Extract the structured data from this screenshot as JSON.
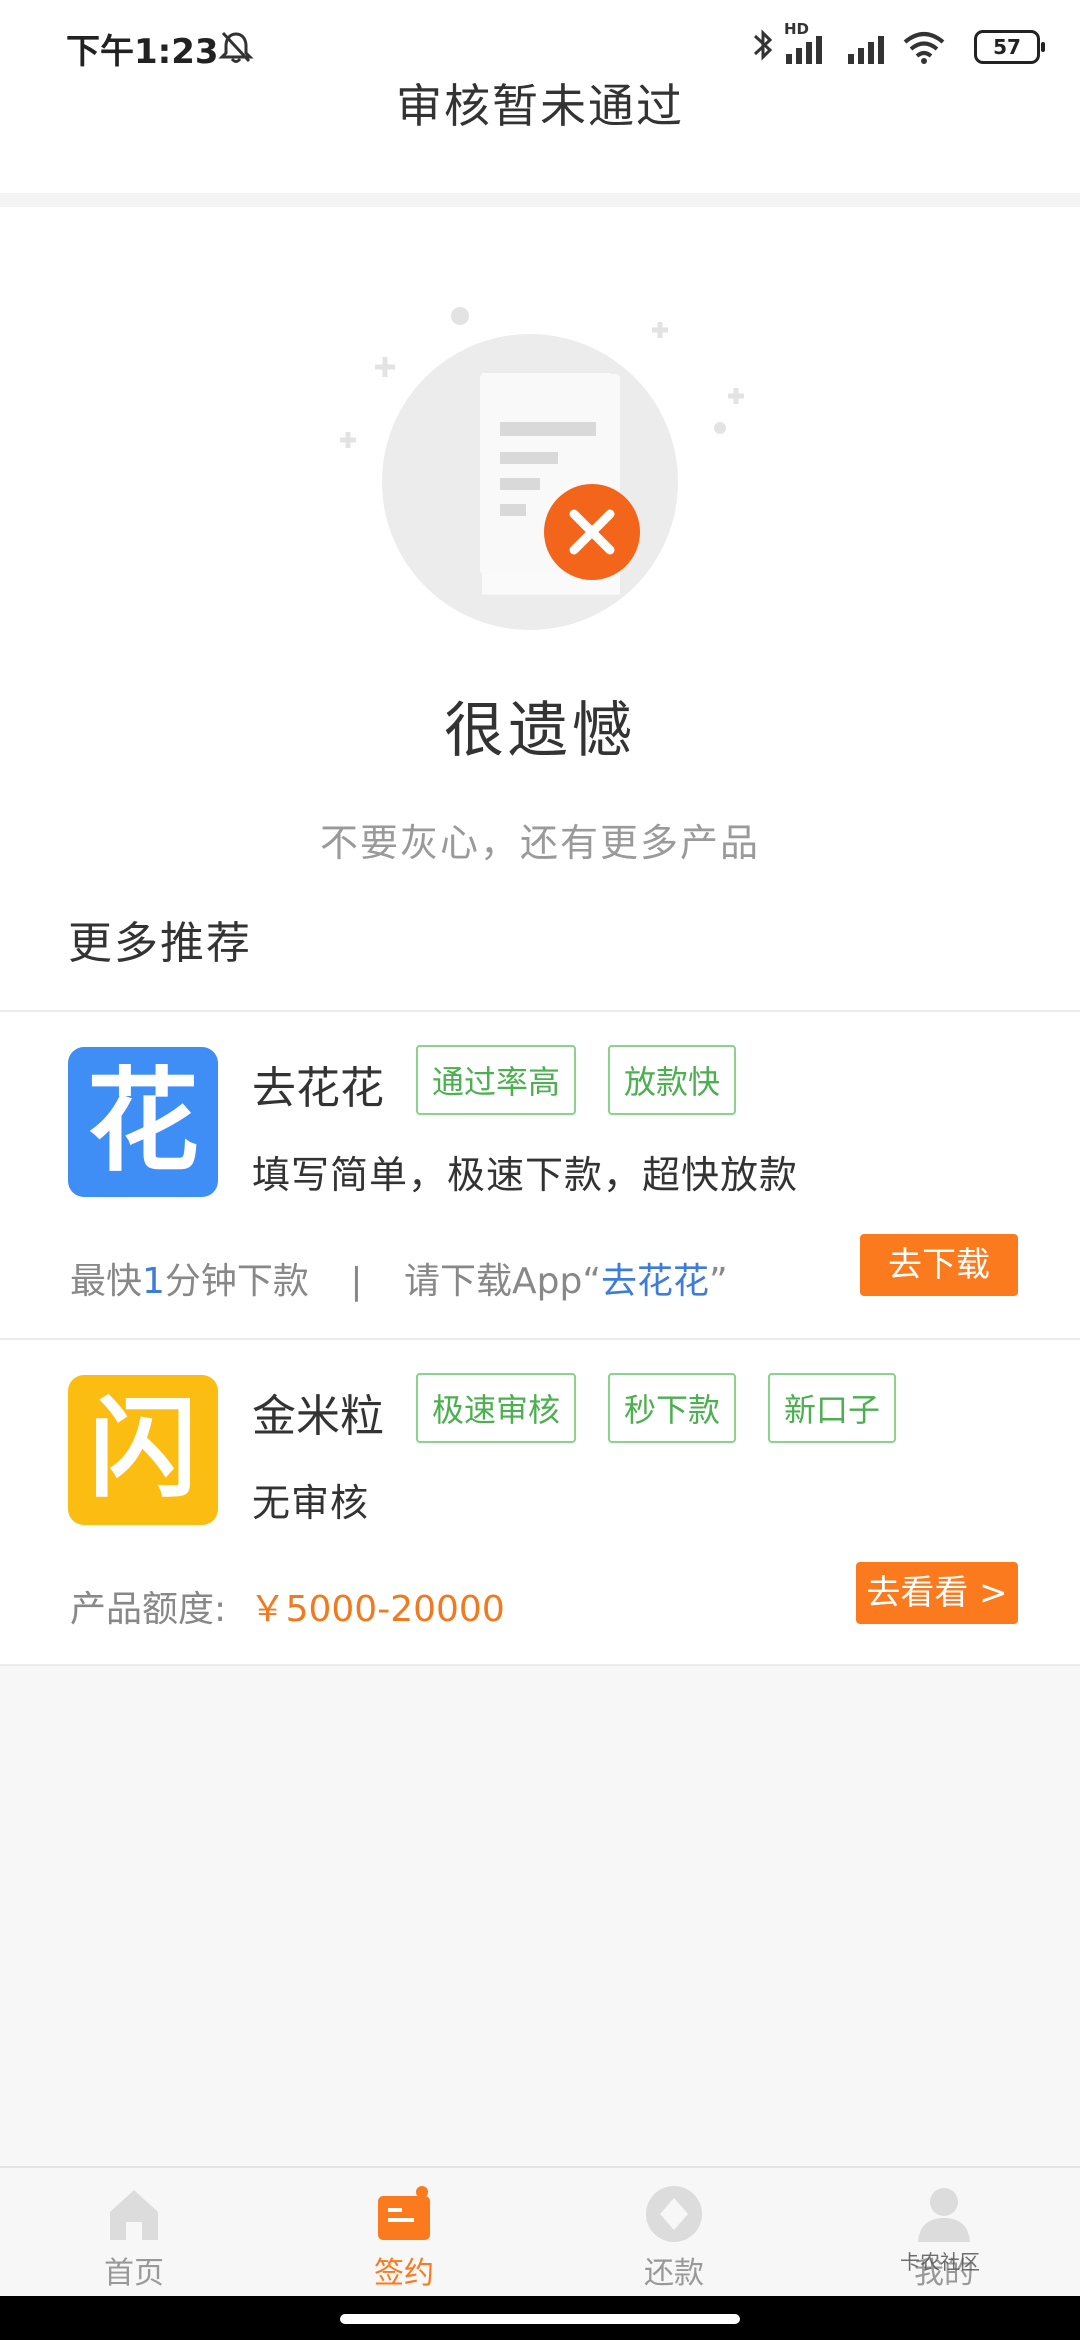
{
  "status_bar": {
    "time": "下午1:23",
    "network_badge": "HD",
    "battery": "57"
  },
  "header": {
    "title": "审核暂未通过"
  },
  "result": {
    "title": "很遗憾",
    "subtitle": "不要灰心，还有更多产品"
  },
  "recommend": {
    "section_title": "更多推荐",
    "items": [
      {
        "name": "去花花",
        "icon_glyph": "花",
        "tags": [
          "通过率高",
          "放款快"
        ],
        "desc": "填写简单，极速下款，超快放款",
        "meta_prefix": "最快",
        "meta_number": "1",
        "meta_suffix": "分钟下款",
        "meta_sep": "|",
        "meta_download_prefix": "请下载App“",
        "meta_download_name": "去花花",
        "meta_download_suffix": "”",
        "button": "去下载"
      },
      {
        "name": "金米粒",
        "icon_glyph": "闪",
        "tags": [
          "极速审核",
          "秒下款",
          "新口子"
        ],
        "desc": "无审核",
        "meta_label": "产品额度:",
        "meta_value": "￥5000-20000",
        "button": "去看看 >"
      }
    ]
  },
  "tabbar": {
    "tabs": [
      {
        "label": "首页",
        "icon": "home-icon",
        "active": false
      },
      {
        "label": "签约",
        "icon": "contract-icon",
        "active": true
      },
      {
        "label": "还款",
        "icon": "repay-icon",
        "active": false
      },
      {
        "label": "我的",
        "icon": "profile-icon",
        "active": false
      }
    ]
  },
  "watermark": "卡农社区",
  "colors": {
    "accent": "#fb7a1e",
    "tag_green": "#4caf50",
    "link_blue": "#3d7dd8"
  }
}
